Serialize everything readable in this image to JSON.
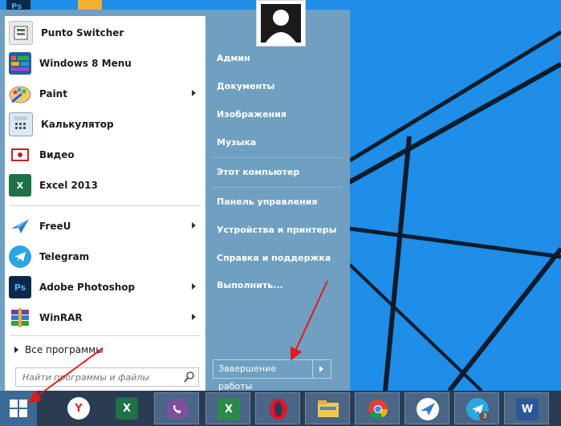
{
  "start_menu": {
    "apps": [
      {
        "label": "Punto Switcher",
        "icon": "punto-switcher-icon",
        "has_submenu": false
      },
      {
        "label": "Windows 8 Menu",
        "icon": "windows8-menu-icon",
        "has_submenu": false
      },
      {
        "label": "Paint",
        "icon": "paint-palette-icon",
        "has_submenu": true
      },
      {
        "label": "Калькулятор",
        "icon": "calculator-icon",
        "has_submenu": false
      },
      {
        "label": "Видео",
        "icon": "video-icon",
        "has_submenu": false
      },
      {
        "label": "Excel 2013",
        "icon": "excel-icon",
        "has_submenu": false
      },
      {
        "label": "FreeU",
        "icon": "freeu-icon",
        "has_submenu": true
      },
      {
        "label": "Telegram",
        "icon": "telegram-icon",
        "has_submenu": false
      },
      {
        "label": "Adobe Photoshop",
        "icon": "photoshop-icon",
        "has_submenu": true
      },
      {
        "label": "WinRAR",
        "icon": "winrar-icon",
        "has_submenu": true
      }
    ],
    "all_programs": "Все программы",
    "search_placeholder": "Найти программы и файлы",
    "right_items": [
      "Админ",
      "Документы",
      "Изображения",
      "Музыка",
      "Этот компьютер",
      "Панель управления",
      "Устройства и принтеры",
      "Справка и поддержка",
      "Выполнить..."
    ],
    "shutdown_label": "Завершение работы",
    "colors": {
      "menu_bg": "#6f9fc1",
      "desktop": "#1e8ee8",
      "taskbar": "#2a3c52"
    }
  },
  "taskbar": {
    "items": [
      {
        "name": "yandex-browser",
        "icon": "yandex-icon",
        "text": "Y"
      },
      {
        "name": "excel",
        "icon": "excel-icon",
        "text": "X"
      },
      {
        "name": "viber",
        "icon": "viber-icon",
        "text": ""
      },
      {
        "name": "excel-alt",
        "icon": "excel-sheet-icon",
        "text": "X"
      },
      {
        "name": "opera",
        "icon": "opera-icon",
        "text": ""
      },
      {
        "name": "file-explorer",
        "icon": "folder-icon",
        "text": ""
      },
      {
        "name": "chrome",
        "icon": "chrome-icon",
        "text": ""
      },
      {
        "name": "freeu",
        "icon": "freeu-icon",
        "text": ""
      },
      {
        "name": "telegram",
        "icon": "telegram-icon",
        "text": "",
        "badge": "3"
      },
      {
        "name": "word",
        "icon": "word-icon",
        "text": "W"
      }
    ]
  },
  "desktop_icons": [
    {
      "name": "photoshop-desktop-icon",
      "text": "Ps"
    },
    {
      "name": "shortcut-desktop-icon",
      "text": ""
    }
  ]
}
